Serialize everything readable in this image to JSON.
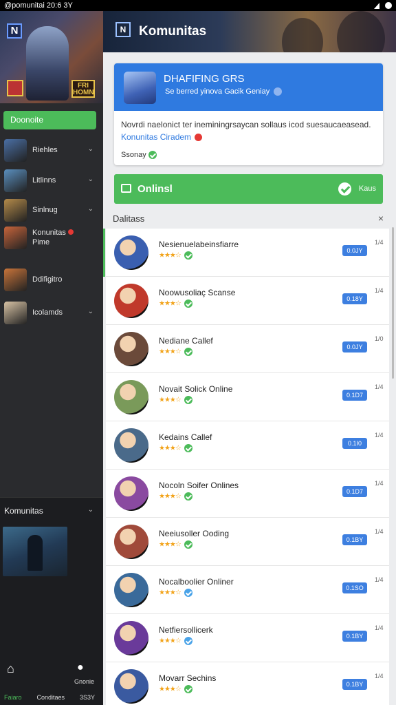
{
  "status_bar": {
    "text": "@pomunitai 20:6 3Y"
  },
  "sidebar": {
    "hero_logo": "N",
    "hero_badge": "FRI HOMN",
    "donate_label": "Doonoite",
    "items": [
      {
        "label": "Riehles",
        "color": "#4a6fa5"
      },
      {
        "label": "Litlinns",
        "color": "#5a8fbf"
      },
      {
        "label": "Sinlnug",
        "color": "#b48a4a"
      },
      {
        "label": "Konunitas",
        "sub": "Pime",
        "color": "#c7643b"
      },
      {
        "label": "Ddifigitro",
        "color": "#c9743a"
      },
      {
        "label": "Icolamds",
        "color": "#d8c3a5"
      }
    ],
    "bottom_header": "Komunitas",
    "footer_items": [
      "Faiaro",
      "Conditaes",
      "3S3Y"
    ],
    "footer_right_label": "Gnonie"
  },
  "banner": {
    "logo": "N",
    "title": "Komunitas"
  },
  "card": {
    "heading": "DHAFIFING GRS",
    "sub": "Se berred yinova Gacik Geniay",
    "description": "Novrdi naelonict ter ineminingrsaycan sollaus icod suesaucaeasead.",
    "link": "Konunitas Ciradem",
    "status": "Ssonay"
  },
  "online_bar": {
    "label": "Onlinsl",
    "right_label": "Kaus"
  },
  "list_header": {
    "title": "Dalitass",
    "close": "×"
  },
  "entries": [
    {
      "name": "Nesienuelabeinsfiarre",
      "badge": "0.0JY",
      "count": "1/4",
      "color": "#3a5fb0",
      "check": "green"
    },
    {
      "name": "Noowusoliaç Scanse",
      "badge": "0.18Y",
      "count": "1/4",
      "color": "#c0392b",
      "check": "green"
    },
    {
      "name": "Nediane Callef",
      "badge": "0.0JY",
      "count": "1/0",
      "color": "#6b4a3a",
      "check": "green"
    },
    {
      "name": "Novait Solick Online",
      "badge": "0.1D7",
      "count": "1/4",
      "color": "#7a9a5a",
      "check": "green"
    },
    {
      "name": "Kedains Callef",
      "badge": "0.1I0",
      "count": "1/4",
      "color": "#4a6a8a",
      "check": "green"
    },
    {
      "name": "Nocoln Soifer Onlines",
      "badge": "0.1D7",
      "count": "1/4",
      "color": "#8a4aa0",
      "check": "green"
    },
    {
      "name": "Neeiusoller Ooding",
      "badge": "0.1BY",
      "count": "1/4",
      "color": "#a04a3a",
      "check": "green"
    },
    {
      "name": "Nocalboolier Onliner",
      "badge": "0.1SO",
      "count": "1/4",
      "color": "#3a6a9a",
      "check": "blue"
    },
    {
      "name": "Netfiersollicerk",
      "badge": "0.1BY",
      "count": "1/4",
      "color": "#6a3a9a",
      "check": "blue"
    },
    {
      "name": "Movarr Sechins",
      "badge": "0.1BY",
      "count": "1/4",
      "color": "#3a5aa0",
      "check": "green"
    }
  ],
  "rating_stars": "★★★☆",
  "colors": {
    "accent_green": "#4cbb5a",
    "accent_blue": "#2f7ae0"
  }
}
